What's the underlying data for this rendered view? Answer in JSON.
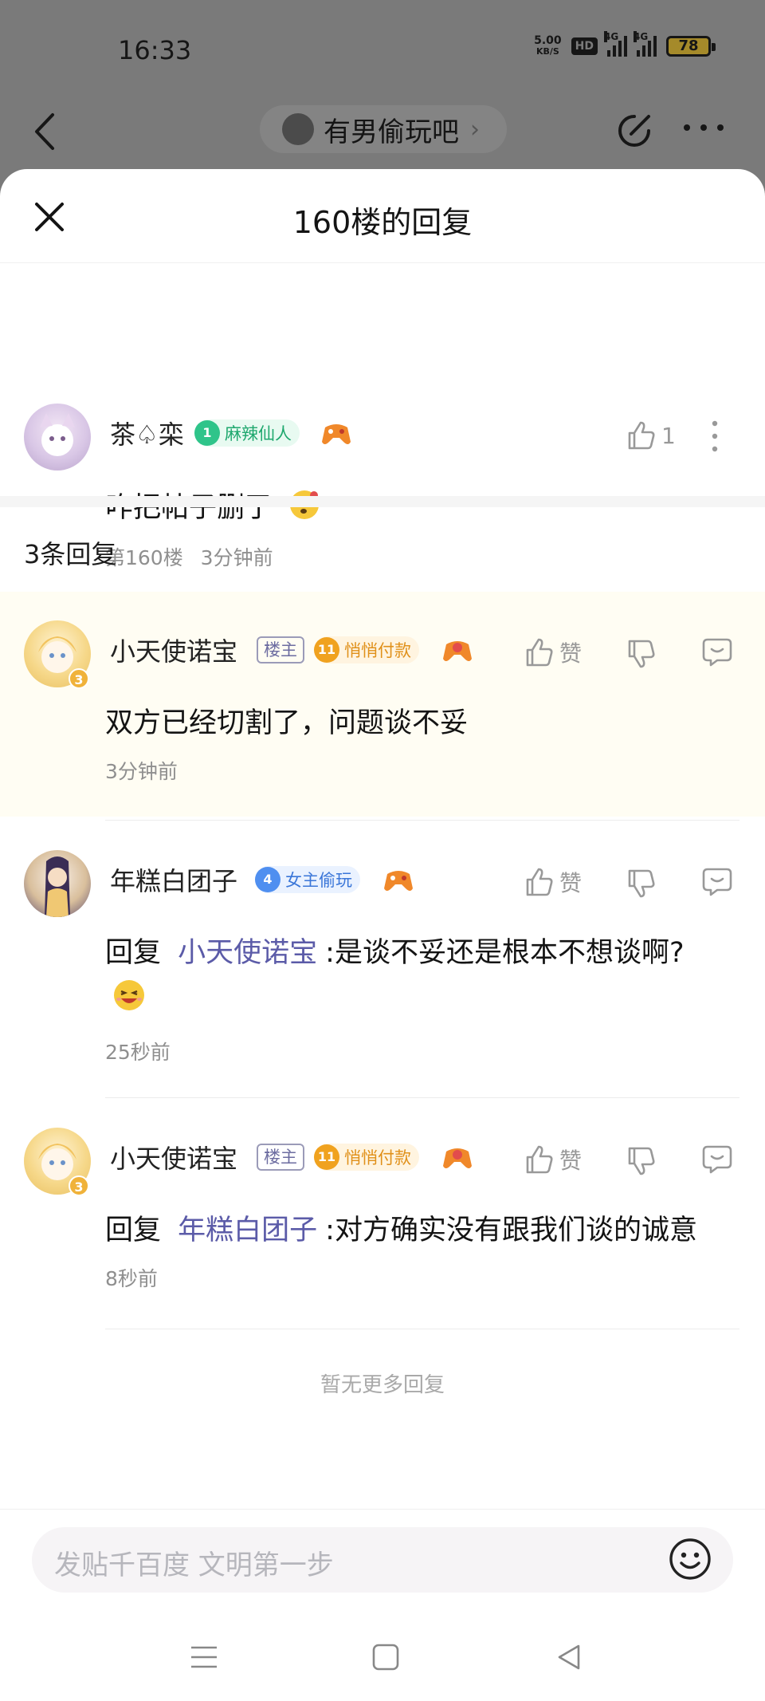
{
  "status_bar": {
    "time": "16:33",
    "net_speed_value": "5.00",
    "net_speed_unit": "KB/S",
    "hd_label": "HD",
    "signal1_label": "4G",
    "signal2_label": "4G",
    "battery": "78"
  },
  "nav": {
    "forum_name": "有男偷玩吧",
    "chevron": "›"
  },
  "sheet": {
    "title": "160楼的回复"
  },
  "main_comment": {
    "username": "茶♤栾",
    "level": "1",
    "badge": "麻辣仙人",
    "like_count": "1",
    "text": "咋把帖子删了",
    "floor": "第160楼",
    "time": "3分钟前"
  },
  "replies_header": "3条回复",
  "replies": [
    {
      "username": "小天使诺宝",
      "owner_tag": "楼主",
      "level": "11",
      "badge": "悄悄付款",
      "avatar_level": "3",
      "like_label": "赞",
      "text": "双方已经切割了，问题谈不妥",
      "time": "3分钟前"
    },
    {
      "username": "年糕白团子",
      "level": "4",
      "badge": "女主偷玩",
      "like_label": "赞",
      "reply_prefix": "回复",
      "reply_to": "小天使诺宝",
      "text": ":是谈不妥还是根本不想谈啊?",
      "time": "25秒前"
    },
    {
      "username": "小天使诺宝",
      "owner_tag": "楼主",
      "level": "11",
      "badge": "悄悄付款",
      "avatar_level": "3",
      "like_label": "赞",
      "reply_prefix": "回复",
      "reply_to": "年糕白团子",
      "text": ":对方确实没有跟我们谈的诚意",
      "time": "8秒前"
    }
  ],
  "no_more": "暂无更多回复",
  "input": {
    "placeholder": "发贴千百度 文明第一步"
  },
  "colors": {
    "accent_link": "#5b5ba8",
    "badge_green": "#2fc48a",
    "badge_gold": "#f0a21f",
    "badge_blue": "#4f8ff0",
    "highlight_bg": "#fffdf3"
  }
}
